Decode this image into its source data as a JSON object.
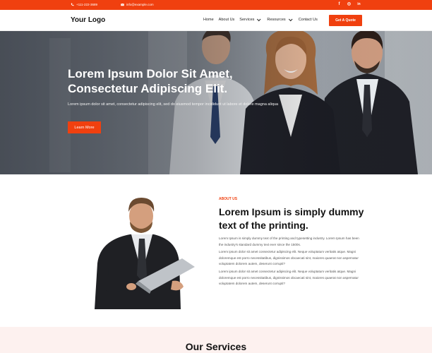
{
  "topbar": {
    "phone": "+111-222-3689",
    "email": "info@example.com",
    "social_icons": [
      "facebook-icon",
      "instagram-icon",
      "linkedin-icon"
    ],
    "facebook_glyph": "f",
    "instagram_glyph": "◎",
    "linkedin_glyph": "in"
  },
  "header": {
    "logo": "Your Logo",
    "nav": [
      {
        "label": "Home"
      },
      {
        "label": "About Us"
      },
      {
        "label": "Services"
      },
      {
        "label": "Resources"
      },
      {
        "label": "Contact Us"
      }
    ],
    "cta": "Get A Quote"
  },
  "hero": {
    "title_line1": "Lorem Ipsum Dolor Sit Amet,",
    "title_line2": "Consectetur Adipiscing Elit.",
    "subtitle": "Lorem ipsum dolor sit amet, consectetur adipiscing elit, sed do eiusmod tempor incididunt ut labore et dolore magna aliqua",
    "button": "Learn More"
  },
  "about": {
    "label": "ABOUT US",
    "title": "Lorem Ipsum is simply dummy text of the printing.",
    "p1": "Lorem Ipsum is simply dummy text of the printing and typesetting industry. Lorem Ipsum has been the industry's standard dummy text ever since the 1500s.",
    "p2": "Lorem ipsum dolor sit amet consectetur adipiscing elit. Neque voluptatum veritatis atque. Magni doloremque est porro necessitatibus, dignissimos obcaecati sint, maiores quaerat non aspernatur voluptatem dolorem autem, deserunt corrupti?",
    "p3": "Lorem ipsum dolor sit amet consectetur adipiscing elit. Neque voluptatum veritatis atque. Magni doloremque est porro necessitatibus, dignissimos obcaecati sint, maiores quaerat non aspernatur voluptatem dolorem autem, deserunt corrupti?"
  },
  "services": {
    "title": "Our Services"
  },
  "colors": {
    "accent": "#f0400f",
    "services_bg": "#fdf1ef"
  }
}
